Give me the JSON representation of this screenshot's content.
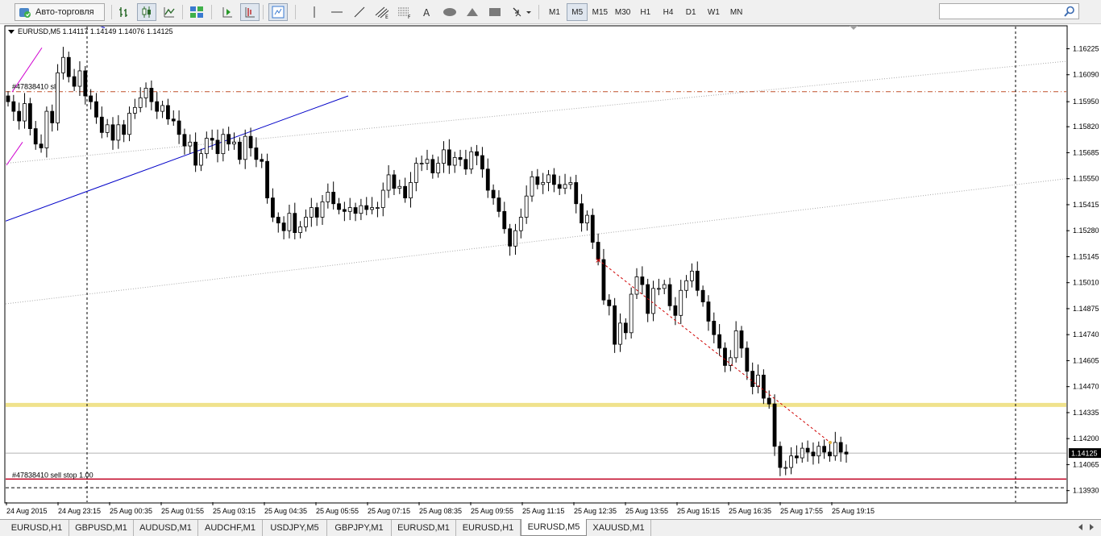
{
  "toolbar": {
    "autotrade_label": "Авто-торговля",
    "timeframes": [
      "M1",
      "M5",
      "M15",
      "M30",
      "H1",
      "H4",
      "D1",
      "W1",
      "MN"
    ],
    "active_timeframe": "M5",
    "search_placeholder": ""
  },
  "chart": {
    "title": "EURUSD,M5  1.14117 1.14149 1.14076 1.14125",
    "symbol": "EURUSD",
    "timeframe": "M5",
    "ohlc": {
      "open": 1.14117,
      "high": 1.14149,
      "low": 1.14076,
      "close": 1.14125
    },
    "current_price": "1.14125",
    "order_sl_label": "#47838410 sl",
    "order_sellstop_label": "#47838410 sell stop 1.00",
    "colors": {
      "candle": "#000000",
      "sl_line": "#c0502a",
      "sellstop_line": "#c00020",
      "yellow_level": "#f0e28c",
      "channel_blue": "#0000c8",
      "magenta": "#d000d0",
      "trend_dots": "#a8a8a8",
      "trade_dashed": "#d00000"
    }
  },
  "chart_data": {
    "type": "candlestick",
    "y_ticks": [
      "1.16225",
      "1.16090",
      "1.15950",
      "1.15820",
      "1.15685",
      "1.15550",
      "1.15415",
      "1.15280",
      "1.15145",
      "1.15010",
      "1.14875",
      "1.14740",
      "1.14605",
      "1.14470",
      "1.14335",
      "1.14200",
      "1.14065",
      "1.13930"
    ],
    "ylim": [
      1.1387,
      1.1634
    ],
    "x_ticks": [
      "24 Aug 2015",
      "24 Aug 23:15",
      "25 Aug 00:35",
      "25 Aug 01:55",
      "25 Aug 03:15",
      "25 Aug 04:35",
      "25 Aug 05:55",
      "25 Aug 07:15",
      "25 Aug 08:35",
      "25 Aug 09:55",
      "25 Aug 11:15",
      "25 Aug 12:35",
      "25 Aug 13:55",
      "25 Aug 15:15",
      "25 Aug 16:35",
      "25 Aug 17:55",
      "25 Aug 19:15"
    ],
    "levels": {
      "sl": 1.16002,
      "yellow": 1.14375,
      "sell_stop": 1.1399,
      "dotted": 1.13945,
      "current": 1.14125
    },
    "closes": [
      1.1595,
      1.159,
      1.1585,
      1.1594,
      1.1581,
      1.1573,
      1.1571,
      1.159,
      1.1584,
      1.161,
      1.1618,
      1.1608,
      1.1603,
      1.1611,
      1.1598,
      1.1595,
      1.1587,
      1.1579,
      1.1583,
      1.1575,
      1.1583,
      1.1578,
      1.1589,
      1.1592,
      1.1597,
      1.1602,
      1.1595,
      1.159,
      1.1593,
      1.1586,
      1.1585,
      1.1578,
      1.1572,
      1.1574,
      1.1562,
      1.1568,
      1.1576,
      1.1575,
      1.1568,
      1.1578,
      1.1573,
      1.1574,
      1.1565,
      1.1577,
      1.1571,
      1.1565,
      1.1564,
      1.1545,
      1.1535,
      1.1532,
      1.1528,
      1.1537,
      1.1527,
      1.153,
      1.1535,
      1.154,
      1.1535,
      1.1543,
      1.1548,
      1.1542,
      1.1539,
      1.1538,
      1.154,
      1.1537,
      1.1541,
      1.1539,
      1.154,
      1.154,
      1.1549,
      1.1557,
      1.155,
      1.1551,
      1.1545,
      1.1553,
      1.1563,
      1.1563,
      1.1565,
      1.1558,
      1.1563,
      1.157,
      1.1562,
      1.1566,
      1.1565,
      1.156,
      1.1569,
      1.1567,
      1.156,
      1.1549,
      1.1545,
      1.1538,
      1.1529,
      1.152,
      1.1528,
      1.1535,
      1.1546,
      1.1556,
      1.1552,
      1.1553,
      1.1557,
      1.1552,
      1.155,
      1.1552,
      1.1553,
      1.1542,
      1.1532,
      1.1536,
      1.1522,
      1.1513,
      1.1492,
      1.1489,
      1.1469,
      1.148,
      1.1475,
      1.1495,
      1.1504,
      1.15,
      1.1485,
      1.1498,
      1.1498,
      1.15,
      1.1489,
      1.1484,
      1.1497,
      1.1502,
      1.1507,
      1.1497,
      1.1491,
      1.1481,
      1.1474,
      1.1467,
      1.1458,
      1.1462,
      1.1476,
      1.1467,
      1.1455,
      1.1447,
      1.1453,
      1.1441,
      1.1438,
      1.1416,
      1.1405,
      1.1405,
      1.1411,
      1.141,
      1.1415,
      1.1413,
      1.1411,
      1.1416,
      1.1413,
      1.1411,
      1.1418,
      1.1413,
      1.1412
    ]
  },
  "tabs": [
    {
      "label": "EURUSD,H1",
      "active": false
    },
    {
      "label": "GBPUSD,M1",
      "active": false
    },
    {
      "label": "AUDUSD,M1",
      "active": false
    },
    {
      "label": "AUDCHF,M1",
      "active": false
    },
    {
      "label": "USDJPY,M5",
      "active": false
    },
    {
      "label": "GBPJPY,M1",
      "active": false
    },
    {
      "label": "EURUSD,M1",
      "active": false
    },
    {
      "label": "EURUSD,H1",
      "active": false
    },
    {
      "label": "EURUSD,M5",
      "active": true
    },
    {
      "label": "XAUUSD,M1",
      "active": false
    }
  ]
}
